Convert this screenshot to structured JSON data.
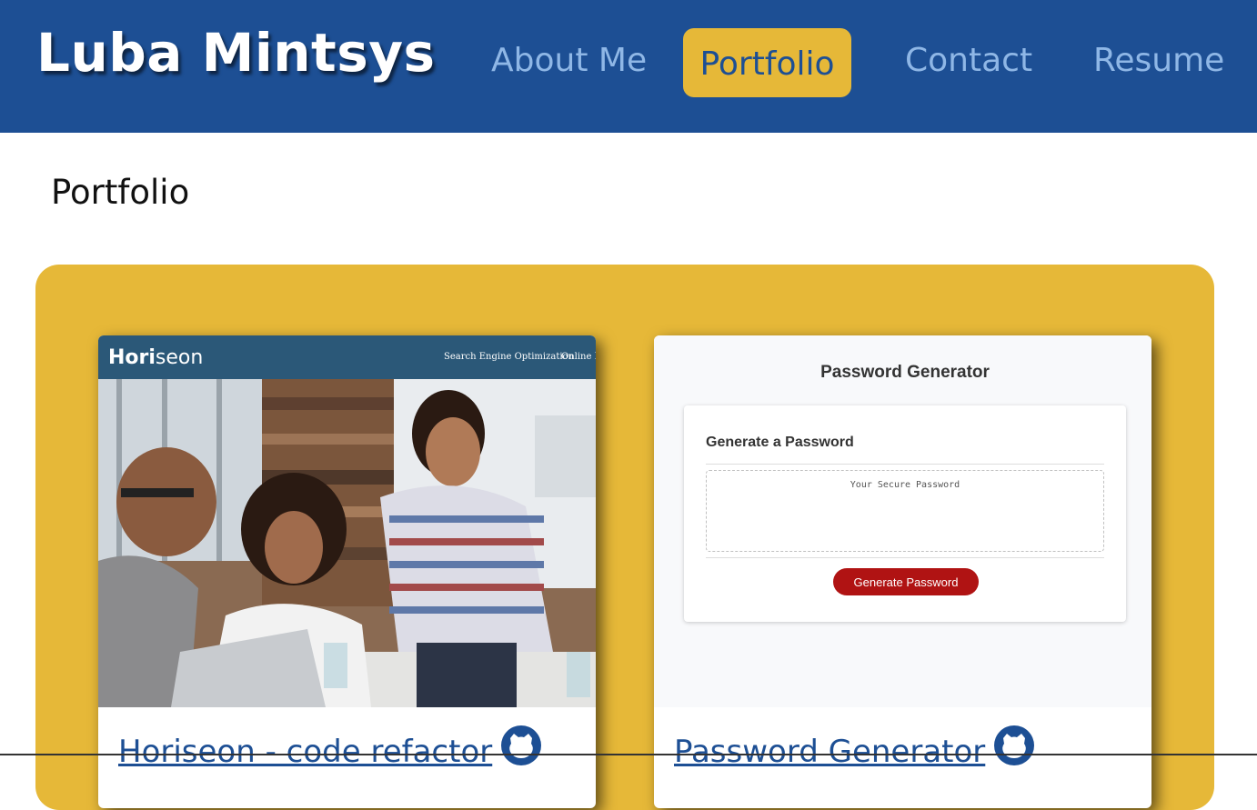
{
  "header": {
    "brand": "Luba Mintsys",
    "nav": [
      "About Me",
      "Portfolio",
      "Contact",
      "Resume"
    ],
    "active_nav": "Portfolio",
    "bg_color": "#1d4f94",
    "accent_color": "#e6b838"
  },
  "main": {
    "title": "Portfolio"
  },
  "projects": [
    {
      "title": "Horiseon - code refactor",
      "icon": "github-icon",
      "screenshot": {
        "logo_bold": "Hori",
        "logo_light": "seon",
        "nav": [
          "Search Engine Optimization",
          "Online R"
        ]
      }
    },
    {
      "title": "Password Generator",
      "icon": "github-icon",
      "screenshot": {
        "heading": "Password Generator",
        "subheading": "Generate a Password",
        "placeholder": "Your Secure Password",
        "button": "Generate Password"
      }
    }
  ]
}
